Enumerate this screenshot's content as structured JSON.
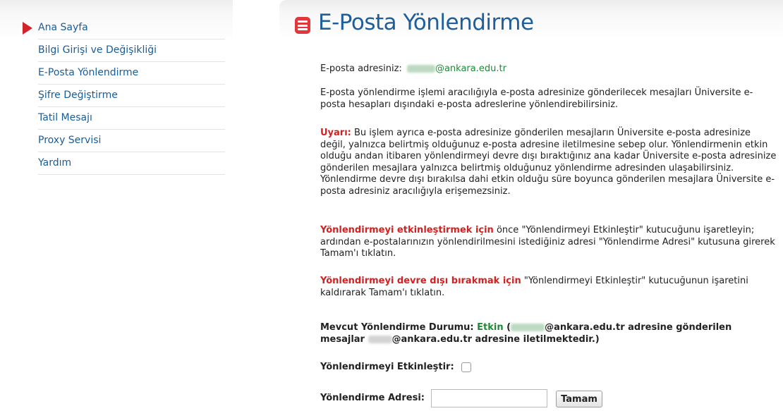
{
  "sidebar": {
    "items": [
      {
        "label": "Ana Sayfa"
      },
      {
        "label": "Bilgi Girişi ve Değişikliği"
      },
      {
        "label": "E-Posta Yönlendirme"
      },
      {
        "label": "Şifre Değiştirme"
      },
      {
        "label": "Tatil Mesajı"
      },
      {
        "label": "Proxy Servisi"
      },
      {
        "label": "Yardım"
      }
    ]
  },
  "page": {
    "title": "E-Posta Yönlendirme",
    "email_label": "E-posta adresiniz:",
    "email_domain": "@ankara.edu.tr",
    "intro": "E-posta yönlendirme işlemi aracılığıyla e-posta adresinize gönderilecek mesajları Üniversite e-posta hesapları dışındaki e-posta adreslerine yönlendirebilirsiniz.",
    "warning_label": "Uyarı:",
    "warning_text": "Bu işlem ayrıca e-posta adresinize gönderilen mesajların Üniversite e-posta adresinize değil, yalnızca belirtmiş olduğunuz e-posta adresine iletilmesine sebep olur. Yönlendirmenin etkin olduğu andan itibaren yönlendirmeyi devre dışı bıraktığınız ana kadar Üniversite e-posta adresinize gönderilen mesajlara yalnızca belirtmiş olduğunuz yönlendirme adresinden ulaşabilirsiniz. Yönlendirme devre dışı bırakılsa dahi etkin olduğu süre boyunca gönderilen mesajlara Üniversite e-posta adresiniz aracılığıyla erişemezsiniz.",
    "enable_label": "Yönlendirmeyi etkinleştirmek için",
    "enable_text": "önce \"Yönlendirmeyi Etkinleştir\" kutucuğunu işaretleyin; ardından e-postalarınızın yönlendirilmesini istediğiniz adresi \"Yönlendirme Adresi\" kutusuna girerek Tamam'ı tıklatın.",
    "disable_label": "Yönlendirmeyi devre dışı bırakmak için",
    "disable_text": "\"Yönlendirmeyi Etkinleştir\" kutucuğunun işaretini kaldırarak Tamam'ı tıklatın.",
    "status_label": "Mevcut Yönlendirme Durumu:",
    "status_value": "Etkin",
    "status_open": "(",
    "status_domain_1": "@ankara.edu.tr adresine gönderilen",
    "status_mid": "mesajlar",
    "status_domain_2": "@ankara.edu.tr adresine iletilmektedir.)",
    "enable_checkbox_label": "Yönlendirmeyi Etkinleştir:",
    "address_label": "Yönlendirme Adresi:",
    "address_value": "",
    "ok_button": "Tamam"
  },
  "colors": {
    "link_blue": "#1a5c99",
    "title_blue": "#1e5e9a",
    "warning_red": "#d42020",
    "status_green": "#1d8a35"
  }
}
